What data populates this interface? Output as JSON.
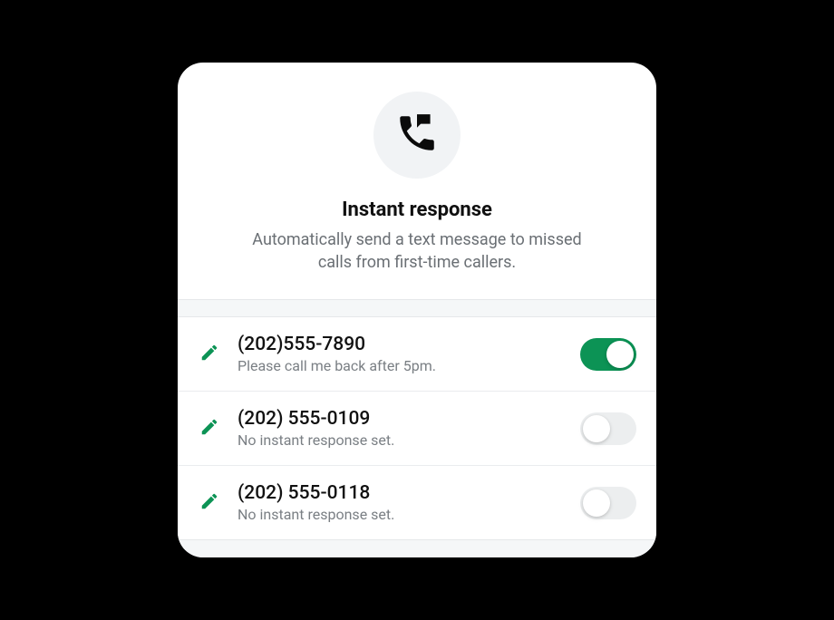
{
  "header": {
    "title": "Instant response",
    "subtitle": "Automatically send a text message to missed calls from first-time callers."
  },
  "rows": [
    {
      "phone": "(202)555-7890",
      "message": "Please call me back after 5pm.",
      "enabled": true
    },
    {
      "phone": "(202) 555-0109",
      "message": "No instant response set.",
      "enabled": false
    },
    {
      "phone": "(202) 555-0118",
      "message": "No instant response set.",
      "enabled": false
    }
  ],
  "colors": {
    "accent": "#0C9355"
  }
}
